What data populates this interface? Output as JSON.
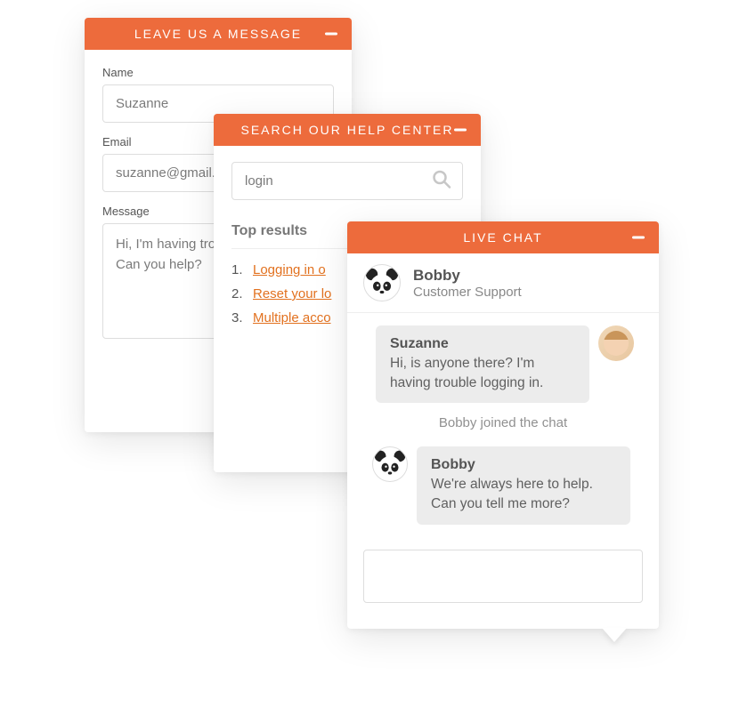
{
  "colors": {
    "accent": "#ed6b3c"
  },
  "message_panel": {
    "title": "LEAVE US A MESSAGE",
    "name_label": "Name",
    "name_value": "Suzanne",
    "email_label": "Email",
    "email_value": "suzanne@gmail.c",
    "body_label": "Message",
    "body_value": "Hi, I'm having troub\nCan you help?"
  },
  "help_panel": {
    "title": "SEARCH OUR HELP CENTER",
    "search_value": "login",
    "results_label": "Top results",
    "results": [
      "Logging in o",
      "Reset your lo",
      "Multiple acco"
    ]
  },
  "chat_panel": {
    "title": "LIVE CHAT",
    "agent": {
      "name": "Bobby",
      "role": "Customer Support"
    },
    "messages": [
      {
        "from": "Suzanne",
        "text": "Hi, is anyone there? I'm having trouble logging in.",
        "side": "right",
        "avatar": "woman"
      },
      {
        "system": "Bobby joined the chat"
      },
      {
        "from": "Bobby",
        "text": "We're always here to help. Can you tell me more?",
        "side": "left",
        "avatar": "panda"
      }
    ],
    "input_value": ""
  }
}
